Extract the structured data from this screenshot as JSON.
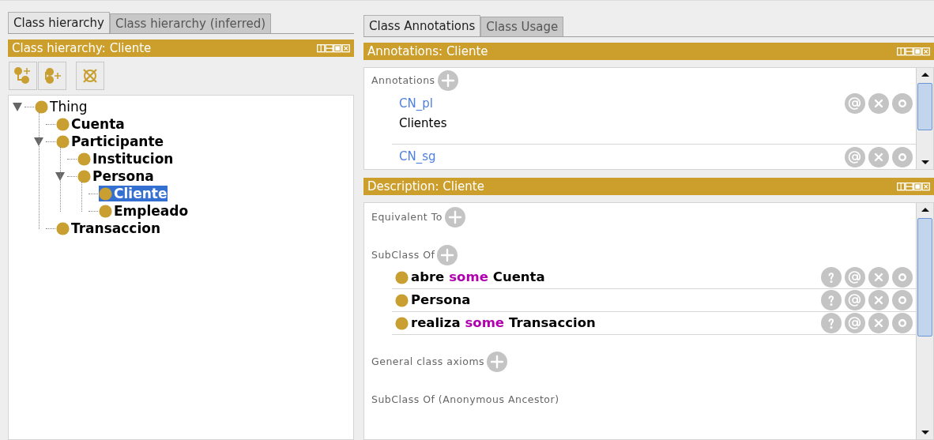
{
  "left": {
    "tabs": [
      {
        "label": "Class hierarchy",
        "selected": true
      },
      {
        "label": "Class hierarchy (inferred)",
        "selected": false
      }
    ],
    "header": "Class hierarchy: Cliente",
    "tree": [
      {
        "label": "Thing",
        "kind": "thing",
        "expanded": true,
        "selected": false,
        "children": [
          {
            "label": "Cuenta",
            "kind": "class",
            "selected": false
          },
          {
            "label": "Participante",
            "kind": "class",
            "expanded": true,
            "selected": false,
            "children": [
              {
                "label": "Institucion",
                "kind": "class",
                "selected": false
              },
              {
                "label": "Persona",
                "kind": "class",
                "expanded": true,
                "selected": false,
                "children": [
                  {
                    "label": "Cliente",
                    "kind": "class",
                    "selected": true
                  },
                  {
                    "label": "Empleado",
                    "kind": "class",
                    "selected": false
                  }
                ]
              }
            ]
          },
          {
            "label": "Transaccion",
            "kind": "class",
            "selected": false
          }
        ]
      }
    ]
  },
  "right": {
    "tabs": [
      {
        "label": "Class Annotations",
        "selected": true
      },
      {
        "label": "Class Usage",
        "selected": false
      }
    ],
    "annotations": {
      "header": "Annotations: Cliente",
      "section": "Annotations",
      "items": [
        {
          "property": "CN_pl",
          "value": "Clientes"
        },
        {
          "property": "CN_sg"
        }
      ]
    },
    "description": {
      "header": "Description: Cliente",
      "sections": [
        {
          "title": "Equivalent To",
          "addable": true
        },
        {
          "title": "SubClass Of",
          "addable": true,
          "items": [
            {
              "parts": [
                {
                  "text": "abre",
                  "kind": "entity"
                },
                {
                  "text": "some",
                  "kind": "keyword"
                },
                {
                  "text": "Cuenta",
                  "kind": "entity"
                }
              ]
            },
            {
              "parts": [
                {
                  "text": "Persona",
                  "kind": "entity"
                }
              ]
            },
            {
              "parts": [
                {
                  "text": "realiza",
                  "kind": "entity"
                },
                {
                  "text": "some",
                  "kind": "keyword"
                },
                {
                  "text": "Transaccion",
                  "kind": "entity"
                }
              ]
            }
          ]
        },
        {
          "title": "General class axioms",
          "addable": true
        },
        {
          "title": "SubClass Of (Anonymous Ancestor)",
          "addable": false
        }
      ]
    }
  }
}
